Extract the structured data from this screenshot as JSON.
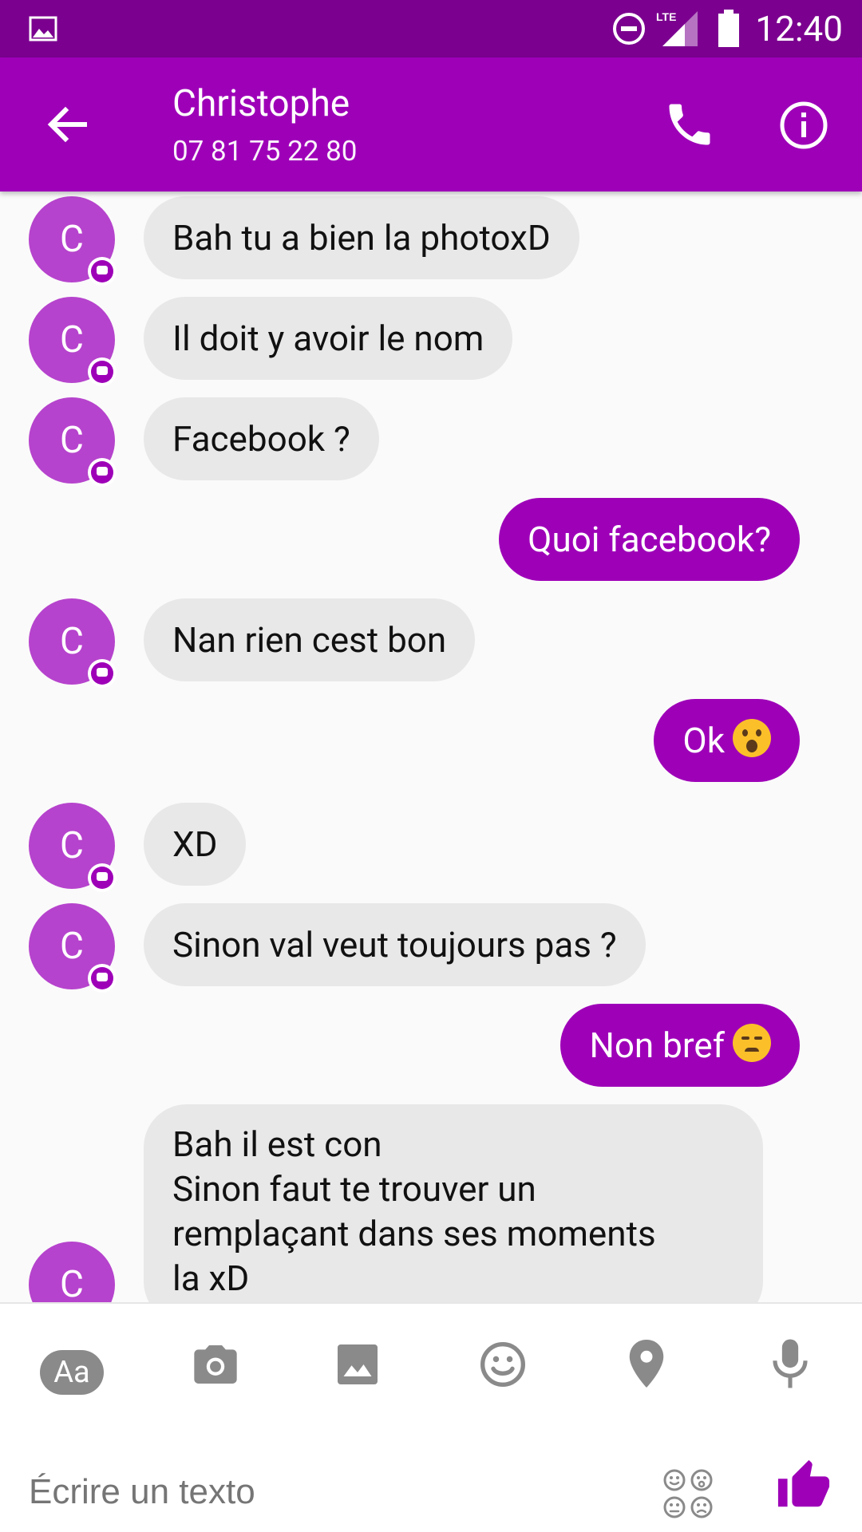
{
  "status_bar": {
    "time": "12:40",
    "network_label": "LTE"
  },
  "header": {
    "contact_name": "Christophe",
    "contact_phone": "07 81 75 22 80"
  },
  "avatar_letter": "C",
  "messages": [
    {
      "direction": "in",
      "text": "Bah tu a bien la photoxD"
    },
    {
      "direction": "in",
      "text": "Il doit y avoir le nom"
    },
    {
      "direction": "in",
      "text": "Facebook ?"
    },
    {
      "direction": "out",
      "text": "Quoi facebook?"
    },
    {
      "direction": "in",
      "text": "Nan rien cest bon"
    },
    {
      "direction": "out",
      "text": "Ok",
      "emoji": "astonished-face"
    },
    {
      "direction": "in",
      "text": "XD"
    },
    {
      "direction": "in",
      "text": "Sinon val veut toujours pas ?"
    },
    {
      "direction": "out",
      "text": "Non bref",
      "emoji": "disappointed-face"
    },
    {
      "direction": "in",
      "lines": [
        "Bah il est con",
        "Sinon faut te trouver un",
        "remplaçant dans ses moments",
        "la xD"
      ]
    }
  ],
  "composer": {
    "aa_label": "Aa",
    "placeholder": "Écrire un texto",
    "tools": [
      "text-format-icon",
      "camera-icon",
      "gallery-icon",
      "emoji-icon",
      "location-icon",
      "microphone-icon"
    ]
  },
  "colors": {
    "status_bar": "#7b008f",
    "app_bar": "#9e00b8",
    "outgoing_bubble": "#9e00b8",
    "incoming_bubble": "#e8e8e8",
    "avatar": "#b643cd"
  }
}
